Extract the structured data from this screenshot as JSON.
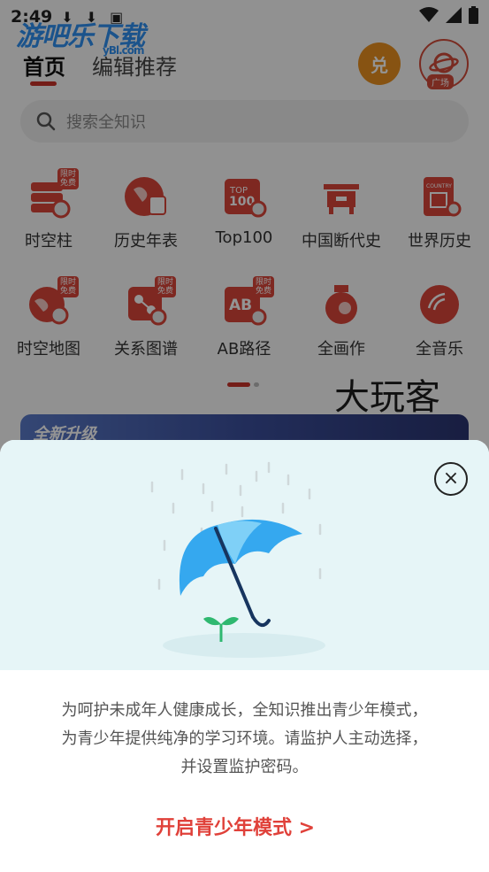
{
  "status_bar": {
    "time": "2:49",
    "icons": [
      "download-icon",
      "download-icon",
      "a-icon",
      "wifi-icon",
      "signal-icon",
      "battery-icon"
    ]
  },
  "watermark": {
    "text": "游吧乐下载",
    "sub": "yBl.com"
  },
  "header": {
    "tabs": [
      {
        "label": "首页",
        "active": true
      },
      {
        "label": "编辑推荐",
        "active": false
      }
    ],
    "redeem_label": "兑",
    "plaza_label": "广场"
  },
  "search": {
    "placeholder": "搜索全知识"
  },
  "grid": {
    "badge_text": "限时免费",
    "items": [
      {
        "label": "时空柱",
        "badge": true
      },
      {
        "label": "历史年表",
        "badge": false
      },
      {
        "label": "Top100",
        "badge": false,
        "icon_text": "TOP 100"
      },
      {
        "label": "中国断代史",
        "badge": false
      },
      {
        "label": "世界历史",
        "badge": false,
        "icon_text": "COUNTRY"
      },
      {
        "label": "时空地图",
        "badge": true
      },
      {
        "label": "关系图谱",
        "badge": true
      },
      {
        "label": "AB路径",
        "badge": true,
        "icon_text": "AB"
      },
      {
        "label": "全画作",
        "badge": false
      },
      {
        "label": "全音乐",
        "badge": false
      }
    ]
  },
  "banner": {
    "text": "全新升级"
  },
  "youth_modal": {
    "description_lines": [
      "为呵护未成年人健康成长，全知识推出青少年模式，",
      "为青少年提供纯净的学习环境。请监护人主动选择，",
      "并设置监护密码。"
    ],
    "enable_link": "开启青少年模式 >",
    "close_symbol": "×"
  },
  "corner_logo": "大玩客",
  "colors": {
    "accent": "#c8322a",
    "link": "#e0413a",
    "hero_bg": "#e6f5f7",
    "umbrella": "#35a8ef"
  }
}
